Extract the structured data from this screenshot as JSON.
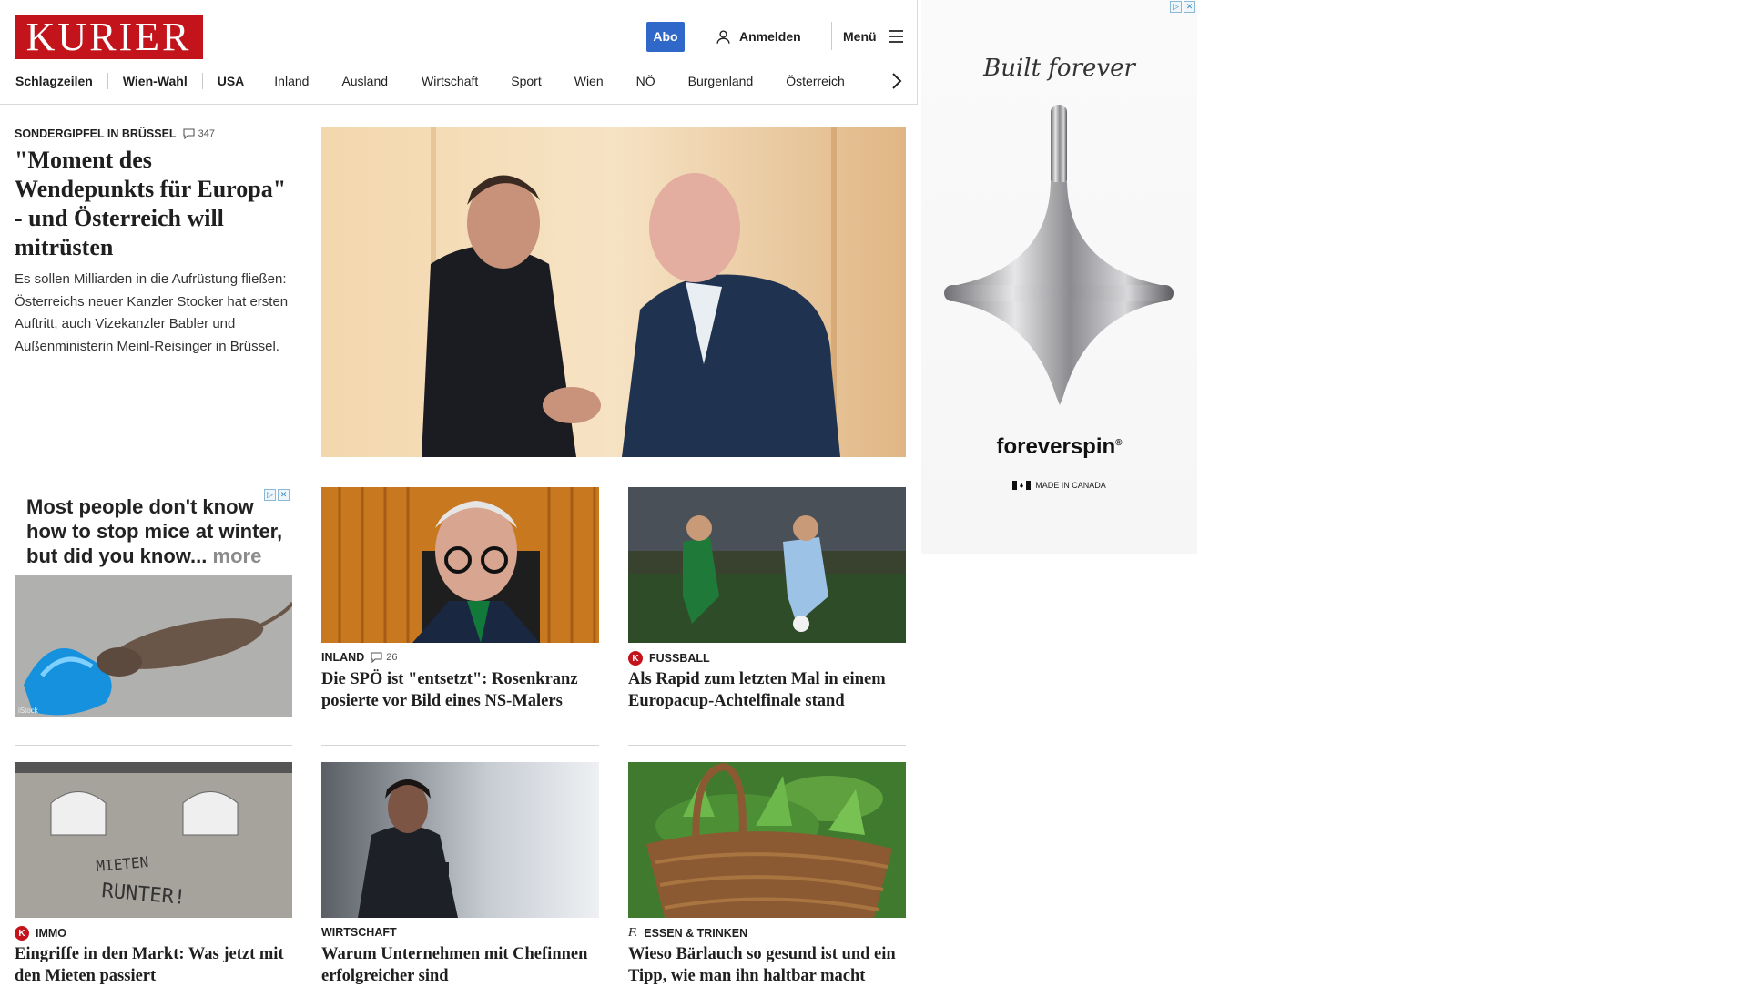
{
  "header": {
    "logo": "KURIER",
    "abo_label": "Abo",
    "login_label": "Anmelden",
    "menu_label": "Menü"
  },
  "nav": {
    "items": [
      "Schlagzeilen",
      "Wien-Wahl",
      "USA",
      "Inland",
      "Ausland",
      "Wirtschaft",
      "Sport",
      "Wien",
      "NÖ",
      "Burgenland",
      "Österreich"
    ]
  },
  "hero": {
    "kicker": "SONDERGIPFEL IN BRÜSSEL",
    "comments": "347",
    "title": "\"Moment des Wendepunkts für Europa\" - und Österreich will mitrüsten",
    "teaser": "Es sollen Milliarden in die Aufrüstung fließen: Österreichs neuer Kanzler Stocker hat ersten Auftritt, auch Vizekanzler Babler und Außenministerin Meinl-Reisinger in Brüssel."
  },
  "ad_mice": {
    "text": "Most people don't know how to stop mice at winter, but did you know...",
    "more": "more",
    "caption": "iStock"
  },
  "cards": [
    {
      "kicker": "INLAND",
      "comments": "26",
      "title": "Die SPÖ ist \"entsetzt\": Rosenkranz posierte vor Bild eines NS-Malers"
    },
    {
      "kicker": "FUSSBALL",
      "title": "Als Rapid zum letzten Mal in einem Europacup-Achtelfinale stand"
    },
    {
      "kicker": "IMMO",
      "title": "Eingriffe in den Markt: Was jetzt mit den Mieten passiert"
    },
    {
      "kicker": "WIRTSCHAFT",
      "title": "Warum Unternehmen mit Chefinnen erfolgreicher sind"
    },
    {
      "kicker": "ESSEN & TRINKEN",
      "title": "Wieso Bärlauch so gesund ist und ein Tipp, wie man ihn haltbar macht"
    }
  ],
  "graffiti_text": "MIETEN RUNTER!",
  "ad_side": {
    "script": "Built forever",
    "brand": "foreverspin",
    "made": "MADE IN CANADA"
  }
}
